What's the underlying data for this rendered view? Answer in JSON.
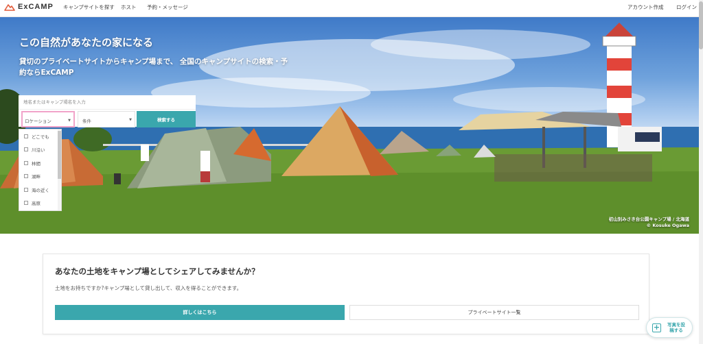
{
  "header": {
    "logo_text": "ExCAMP",
    "nav": [
      "キャンプサイトを探す",
      "ホスト",
      "予約・メッセージ"
    ],
    "account": "アカウント作成",
    "login": "ログイン"
  },
  "hero": {
    "title": "この自然があなたの家になる",
    "subtitle": "貸切のプライベートサイトからキャンプ場まで、 全国のキャンプサイトの検索・予約ならExCAMP",
    "credit_place": "初山別みさき台公園キャンプ場 / 北海道",
    "credit_photo": "© Kosuke Ogawa"
  },
  "search": {
    "placeholder": "地名またはキャンプ場名を入力",
    "location_label": "ロケーション",
    "condition_label": "条件",
    "button": "検索する",
    "location_options": [
      "どこでも",
      "川沿い",
      "林間",
      "湖畔",
      "海の近く",
      "高原"
    ]
  },
  "host_card": {
    "title": "あなたの土地をキャンプ場としてシェアしてみませんか？",
    "text": "土地をお持ちですか?キャンプ場として貸し出して、収入を得ることができます。",
    "primary_button": "詳しくはこちら",
    "secondary_button": "プライベートサイト一覧"
  },
  "fab": {
    "label": "写真を投稿する",
    "icon": "plus-square-icon"
  },
  "colors": {
    "accent": "#3aa7ad",
    "focus_border": "#f1a3c9"
  }
}
